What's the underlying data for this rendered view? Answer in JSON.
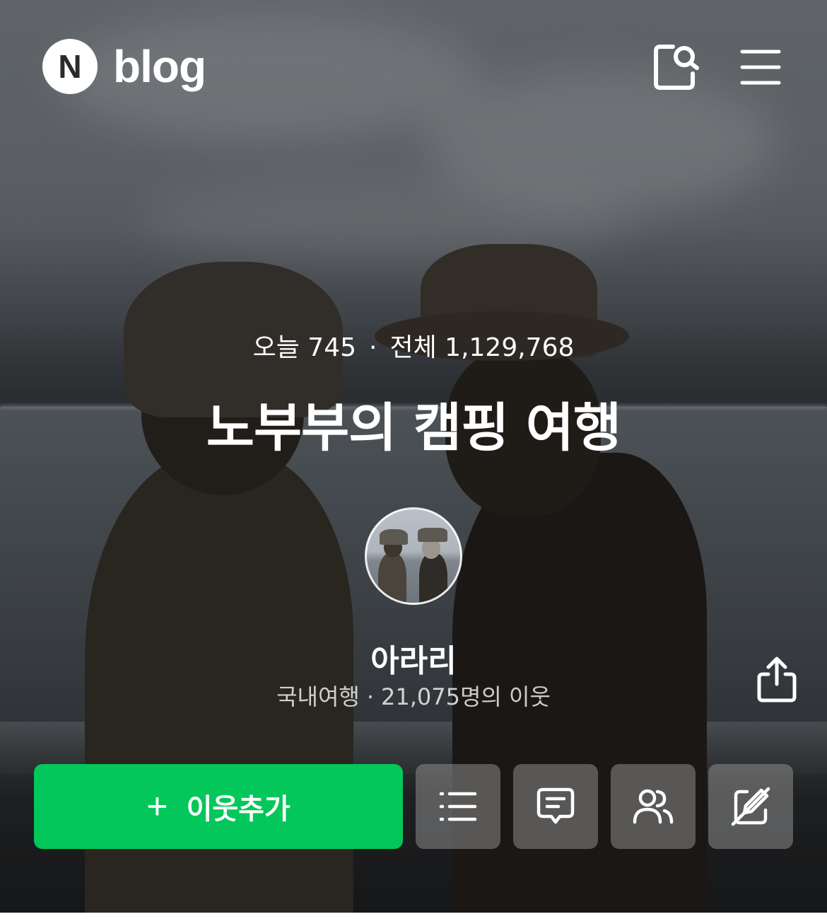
{
  "header": {
    "logo_letter": "N",
    "logo_text": "blog",
    "search_icon": "search-page-icon",
    "menu_icon": "hamburger-menu-icon"
  },
  "stats": {
    "today_label": "오늘",
    "today_count": "745",
    "separator": "·",
    "total_label": "전체",
    "total_count": "1,129,768"
  },
  "blog": {
    "title": "노부부의 캠핑 여행",
    "nickname": "아라리",
    "category": "국내여행",
    "separator": "·",
    "neighbors": "21,075명의 이웃"
  },
  "actions": {
    "add_plus": "+",
    "add_label": "이웃추가",
    "list_icon": "list-icon",
    "guestbook_icon": "chat-bubble-icon",
    "neighbors_icon": "people-icon",
    "edit_off_icon": "pen-slash-icon",
    "share_icon": "share-icon"
  },
  "colors": {
    "brand_green": "#03c75a"
  }
}
